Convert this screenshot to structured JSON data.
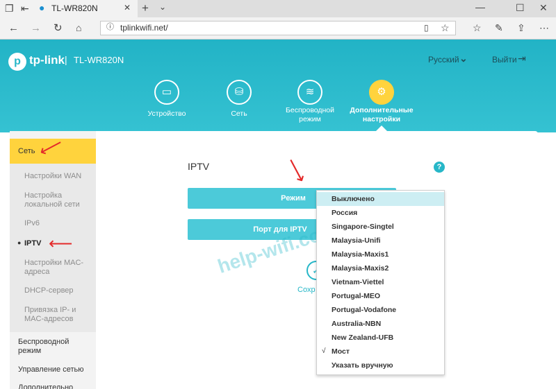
{
  "browser": {
    "tab_title": "TL-WR820N",
    "url": "tplinkwifi.net/"
  },
  "header": {
    "logo": "tp-link",
    "model": "TL-WR820N",
    "language": "Русский",
    "exit": "Выйти",
    "nav": [
      {
        "line1": "Устройство",
        "line2": ""
      },
      {
        "line1": "Сеть",
        "line2": ""
      },
      {
        "line1": "Беспроводной",
        "line2": "режим"
      },
      {
        "line1": "Дополнительные",
        "line2": "настройки"
      }
    ]
  },
  "sidebar": {
    "active_section": "Сеть",
    "sub": {
      "wan": "Настройки WAN",
      "lan1": "Настройка",
      "lan2": "локальной сети",
      "ipv6": "IPv6",
      "iptv": "IPTV",
      "mac1": "Настройки MAC-",
      "mac2": "адреса",
      "dhcp": "DHCP-сервер",
      "bind1": "Привязка IP- и",
      "bind2": "MAC-адресов"
    },
    "wireless1": "Беспроводной",
    "wireless2": "режим",
    "manage": "Управление сетью",
    "extra": "Дополнительно"
  },
  "content": {
    "title": "IPTV",
    "mode_label": "Режим",
    "port_label": "Порт для IPTV",
    "save_label": "Сохр",
    "dropdown": {
      "highlighted": "Выключено",
      "items": [
        "Выключено",
        "Россия",
        "Singapore-Singtel",
        "Malaysia-Unifi",
        "Malaysia-Maxis1",
        "Malaysia-Maxis2",
        "Vietnam-Viettel",
        "Portugal-MEO",
        "Portugal-Vodafone",
        "Australia-NBN",
        "New Zealand-UFB",
        "Мост",
        "Указать вручную"
      ],
      "checked": "Мост"
    }
  },
  "watermark": "help-wifi.com",
  "colors": {
    "accent": "#27b7c8",
    "active": "#ffd33d",
    "arrow": "#e42a2a"
  }
}
